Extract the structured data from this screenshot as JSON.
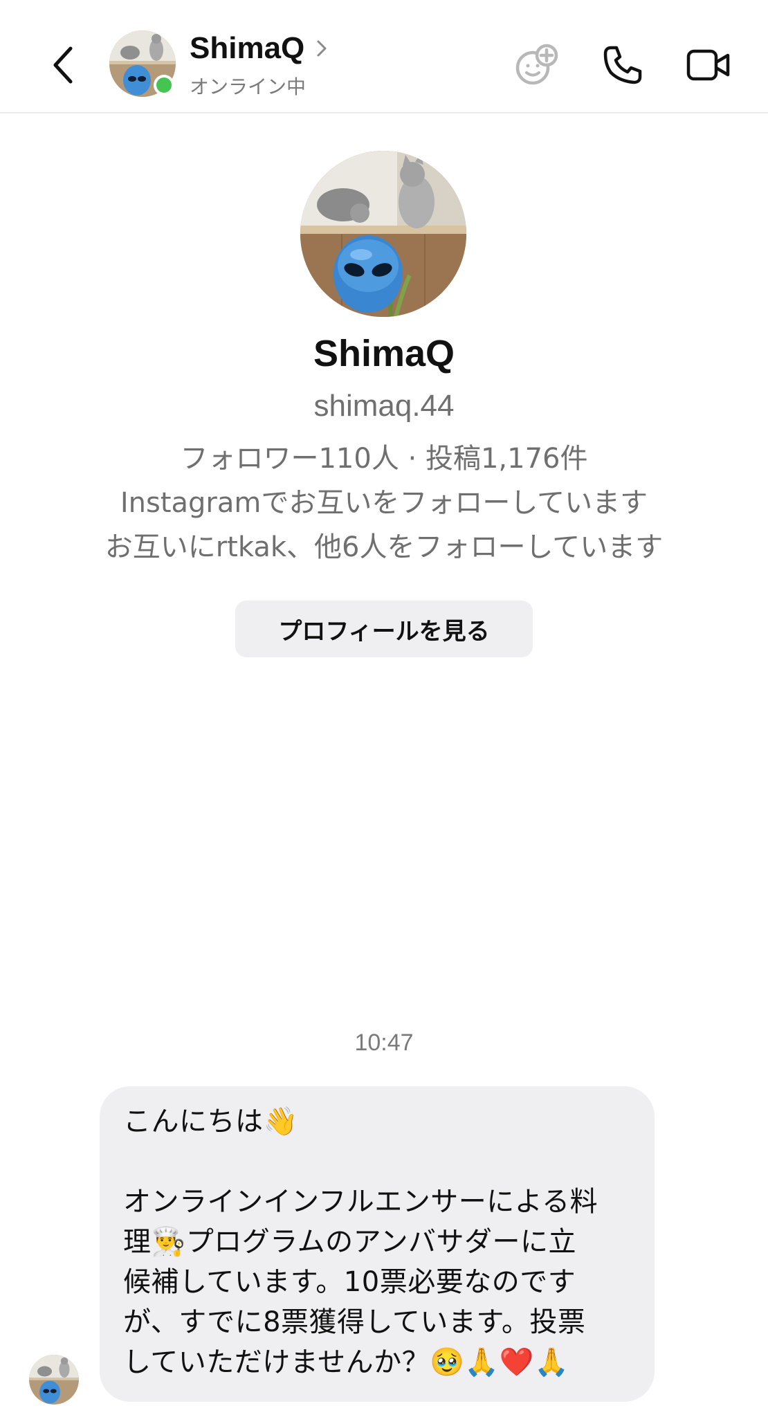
{
  "header": {
    "name": "ShimaQ",
    "status": "オンライン中",
    "colors": {
      "online": "#44c552"
    },
    "icons": [
      "back-chevron-icon",
      "chevron-right-icon",
      "game-controller-add-icon",
      "phone-icon",
      "video-camera-icon"
    ]
  },
  "profile": {
    "name": "ShimaQ",
    "handle": "shimaq.44",
    "stats": "フォロワー110人 · 投稿1,176件",
    "mutual": "Instagramでお互いをフォローしています",
    "followed_by": "お互いにrtkak、他6人をフォローしています",
    "view_profile_button": "プロフィールを見る"
  },
  "chat": {
    "timestamp": "10:47",
    "message": {
      "line1": "こんにちは",
      "line1_emoji": "👋",
      "line2": "オンラインインフルエンサーによる料",
      "line3_a": "理",
      "line3_emoji": "👨‍🍳",
      "line3_b": "プログラムのアンバサダーに立",
      "line4": "候補しています。10票必要なのです",
      "line5": "が、すでに8票獲得しています。投票",
      "line6": "していただけませんか？",
      "line6_emoji": "🥹🙏❤️🙏"
    }
  }
}
